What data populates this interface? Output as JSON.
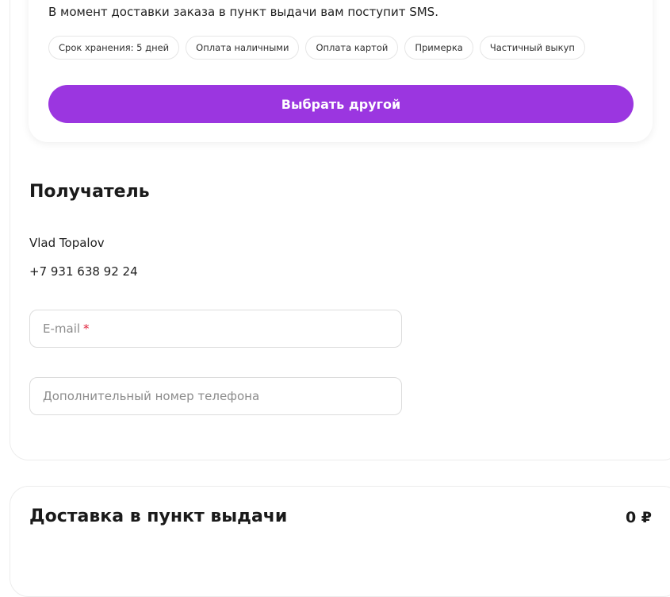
{
  "pickup": {
    "sms_note": "В момент доставки заказа в пункт выдачи вам поступит SMS.",
    "tags": [
      "Срок хранения: 5 дней",
      "Оплата наличными",
      "Оплата картой",
      "Примерка",
      "Частичный выкуп"
    ],
    "choose_other_label": "Выбрать другой"
  },
  "recipient": {
    "title": "Получатель",
    "name": "Vlad Topalov",
    "phone": "+7 931 638 92 24",
    "email_placeholder": "E-mail",
    "email_required_mark": "*",
    "extra_phone_placeholder": "Дополнительный номер телефона"
  },
  "delivery": {
    "title": "Доставка в пункт выдачи",
    "price": "0 ₽"
  },
  "colors": {
    "accent": "#9b36e0",
    "required": "#e0223b"
  }
}
